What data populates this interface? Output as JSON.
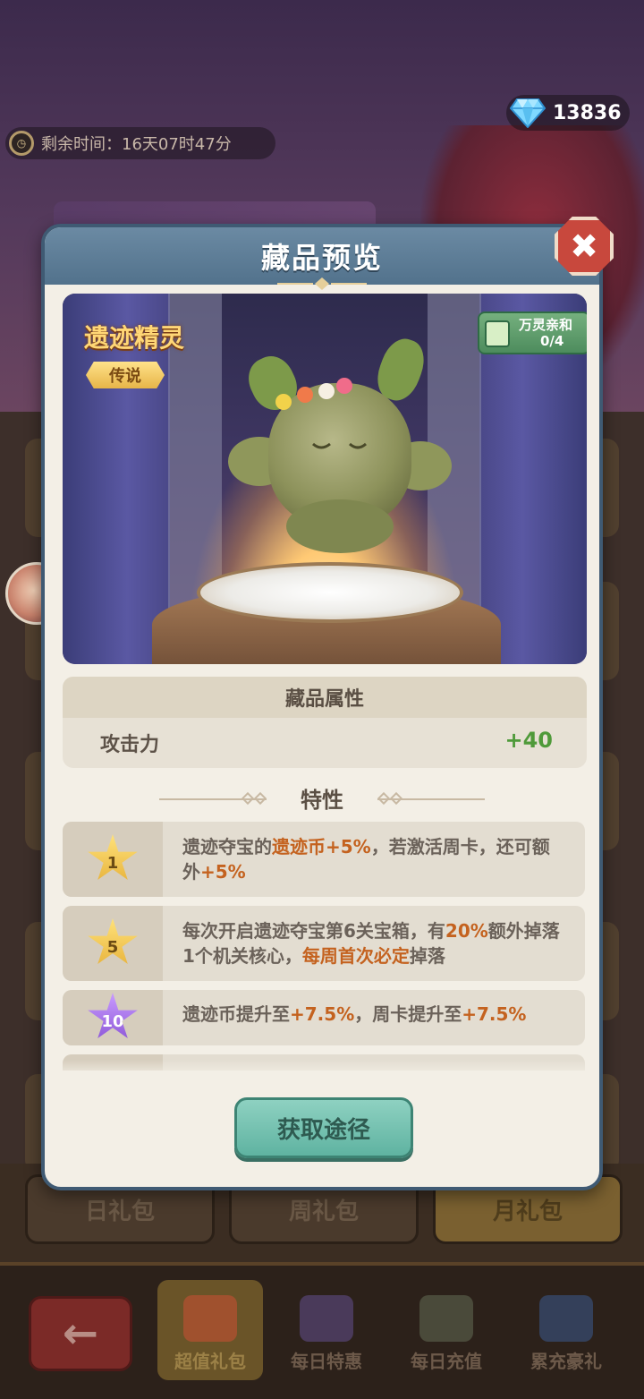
{
  "currency": {
    "gems": "13836",
    "gem_icon": "diamond-icon"
  },
  "timer": {
    "label": "剩余时间：16天07时47分",
    "icon": "clock-icon"
  },
  "modal": {
    "title": "藏品预览",
    "item_name": "遗迹精灵",
    "rarity": "传说",
    "affinity": {
      "label": "万灵亲和",
      "count": "0/4"
    },
    "attributes": {
      "header": "藏品属性",
      "rows": [
        {
          "name": "攻击力",
          "value": "+40"
        }
      ]
    },
    "traits_title": "特性",
    "traits": [
      {
        "level": "1",
        "star": "gold",
        "parts": [
          {
            "t": "遗迹夺宝的",
            "h": false
          },
          {
            "t": "遗迹币+5%",
            "h": true
          },
          {
            "t": "，若激活周卡，还可额外",
            "h": false
          },
          {
            "t": "+5%",
            "h": true
          }
        ]
      },
      {
        "level": "5",
        "star": "gold",
        "parts": [
          {
            "t": "每次开启遗迹夺宝第6关宝箱，有",
            "h": false
          },
          {
            "t": "20%",
            "h": true
          },
          {
            "t": "额外掉落1个机关核心，",
            "h": false
          },
          {
            "t": "每周首次必定",
            "h": true
          },
          {
            "t": "掉落",
            "h": false
          }
        ]
      },
      {
        "level": "10",
        "star": "purple",
        "parts": [
          {
            "t": "遗迹币提升至",
            "h": false
          },
          {
            "t": "+7.5%",
            "h": true
          },
          {
            "t": "，周卡提升至",
            "h": false
          },
          {
            "t": "+7.5%",
            "h": true
          }
        ]
      }
    ],
    "action_button": "获取途径",
    "close_icon": "close-icon"
  },
  "background": {
    "tabs": [
      "日礼包",
      "周礼包",
      "月礼包"
    ],
    "bottom_nav": [
      "超值礼包",
      "每日特惠",
      "每日充值",
      "累充豪礼"
    ],
    "back_icon": "arrow-left-icon"
  },
  "colors": {
    "highlight": "#c4621f",
    "stat_positive": "#4f9a3a",
    "header": "#52728c",
    "button": "#5fb3a1"
  }
}
